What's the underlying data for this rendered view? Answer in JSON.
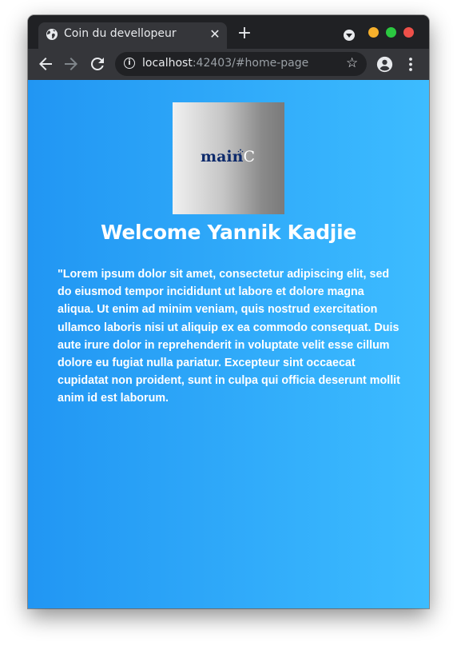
{
  "browser": {
    "tab": {
      "title": "Coin du devellopeur",
      "favicon": "globe-icon",
      "close_icon": "close-icon"
    },
    "new_tab_icon": "plus-icon",
    "tab_search_icon": "chevron-down-icon",
    "window_controls": {
      "minimize_color": "#f6b02c",
      "maximize_color": "#2bc840",
      "close_color": "#ee5049"
    },
    "toolbar": {
      "back_icon": "arrow-left-icon",
      "forward_icon": "arrow-right-icon",
      "reload_icon": "reload-icon",
      "site_info_icon": "info-icon",
      "url_host": "localhost",
      "url_rest": ":42403/#home-page",
      "bookmark_icon": "star-icon",
      "account_icon": "account-icon",
      "menu_icon": "kebab-menu-icon"
    }
  },
  "page": {
    "background_gradient": [
      "#2196f3",
      "#3dbcff"
    ],
    "logo": {
      "text_main": "main",
      "text_suffix": "C",
      "text_color": "#0d2a6b"
    },
    "welcome": "Welcome Yannik Kadjie",
    "lorem": "\"Lorem ipsum dolor sit amet, consectetur adipiscing elit, sed do eiusmod tempor incididunt ut labore et dolore magna aliqua. Ut enim ad minim veniam, quis nostrud exercitation ullamco laboris nisi ut aliquip ex ea commodo consequat. Duis aute irure dolor in reprehenderit in voluptate velit esse cillum dolore eu fugiat nulla pariatur. Excepteur sint occaecat cupidatat non proident, sunt in culpa qui officia deserunt mollit anim id est laborum."
  }
}
